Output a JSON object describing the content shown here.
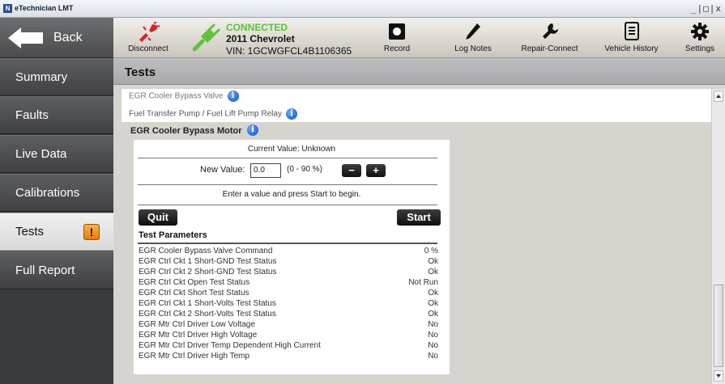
{
  "window": {
    "title": "eTechnician LMT",
    "app_icon_letter": "N",
    "controls": "_|□|x"
  },
  "sidebar": {
    "back_label": "Back",
    "items": [
      {
        "label": "Summary"
      },
      {
        "label": "Faults"
      },
      {
        "label": "Live Data"
      },
      {
        "label": "Calibrations"
      },
      {
        "label": "Tests",
        "active": true,
        "badge": "!"
      },
      {
        "label": "Full Report"
      }
    ]
  },
  "toolbar": {
    "disconnect_label": "Disconnect",
    "connection": {
      "status": "CONNECTED",
      "vehicle": "2011 Chevrolet",
      "vin": "VIN: 1GCWGFCL4B1106365"
    },
    "record_label": "Record",
    "log_notes_label": "Log Notes",
    "repair_connect_label": "Repair-Connect",
    "vehicle_history_label": "Vehicle History",
    "settings_label": "Settings"
  },
  "page": {
    "title": "Tests"
  },
  "test_list": {
    "items": [
      {
        "label": "EGR Cooler Bypass Valve"
      },
      {
        "label": "Fuel Transfer Pump / Fuel Lift Pump Relay"
      }
    ],
    "selected": "EGR Cooler Bypass Motor"
  },
  "test_panel": {
    "current_value_label": "Current Value:",
    "current_value": "Unknown",
    "new_value_label": "New Value:",
    "new_value": "0.0",
    "range": "(0 - 90 %)",
    "decrement": "−",
    "increment": "+",
    "instruction": "Enter a value and press Start to begin.",
    "quit_label": "Quit",
    "start_label": "Start",
    "params_title": "Test Parameters",
    "params": [
      {
        "name": "EGR Cooler Bypass Valve Command",
        "value": "0 %"
      },
      {
        "name": "EGR Ctrl Ckt 1 Short-GND Test Status",
        "value": "Ok"
      },
      {
        "name": "EGR Ctrl Ckt 2 Short-GND Test Status",
        "value": "Ok"
      },
      {
        "name": "EGR Ctrl Ckt Open Test Status",
        "value": "Not Run"
      },
      {
        "name": "EGR Ctrl Ckt Short Test Status",
        "value": "Ok"
      },
      {
        "name": "EGR Ctrl Ckt 1 Short-Volts Test Status",
        "value": "Ok"
      },
      {
        "name": "EGR Ctrl Ckt 2 Short-Volts Test Status",
        "value": "Ok"
      },
      {
        "name": "EGR Mtr Ctrl Driver Low Voltage",
        "value": "No"
      },
      {
        "name": "EGR Mtr Ctrl Driver High Voltage",
        "value": "No"
      },
      {
        "name": "EGR Mtr Ctrl Driver Temp Dependent High Current",
        "value": "No"
      },
      {
        "name": "EGR Mtr Ctrl Driver High Temp",
        "value": "No"
      }
    ]
  },
  "icons": {
    "disconnect": "disconnect-plug-icon",
    "connected": "connected-plug-icon",
    "record": "record-icon",
    "log_notes": "pencil-icon",
    "repair_connect": "wrench-icon",
    "vehicle_history": "document-icon",
    "settings": "gear-icon",
    "info": "info-icon",
    "back": "back-arrow-icon"
  },
  "colors": {
    "connected_status": "#5ec23a",
    "badge": "#f29a1f",
    "disconnect_red": "#d2252b",
    "connected_green": "#5ec23a",
    "info_blue": "#0b4fc4"
  }
}
